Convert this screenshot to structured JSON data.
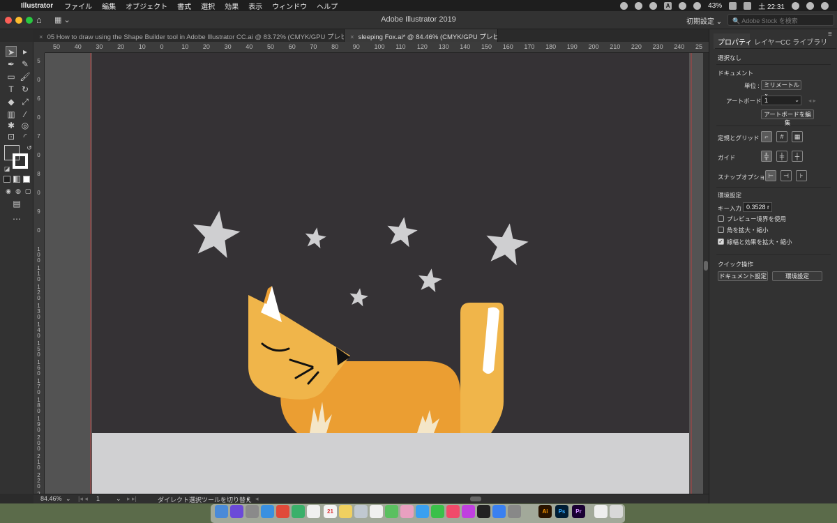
{
  "menubar": {
    "app": "Illustrator",
    "items": [
      "ファイル",
      "編集",
      "オブジェクト",
      "書式",
      "選択",
      "効果",
      "表示",
      "ウィンドウ",
      "ヘルプ"
    ],
    "battery": "43%",
    "clock": "土 22:31"
  },
  "appbar": {
    "title": "Adobe Illustrator 2019",
    "preset": "初期設定 ⌄",
    "stock_placeholder": "Adobe Stock を検索"
  },
  "tabs": [
    {
      "label": "05 How to draw using the Shape Builder tool in Adobe Illustrator CC.ai @ 83.72% (CMYK/GPU プレビュー)"
    },
    {
      "label": "sleeping Fox.ai* @ 84.46% (CMYK/GPU プレビュー)"
    }
  ],
  "ruler_h": [
    "50",
    "40",
    "30",
    "20",
    "10",
    "0",
    "10",
    "20",
    "30",
    "40",
    "50",
    "60",
    "70",
    "80",
    "90",
    "100",
    "110",
    "120",
    "130",
    "140",
    "150",
    "160",
    "170",
    "180",
    "190",
    "200",
    "210",
    "220",
    "230",
    "240",
    "25"
  ],
  "ruler_v": [
    "5",
    "0",
    "6",
    "0",
    "7",
    "0",
    "8",
    "0",
    "9",
    "0",
    "1 0 0",
    "1 1 0",
    "1 2 0",
    "1 3 0",
    "1 4 0",
    "1 5 0",
    "1 6 0",
    "1 7 0",
    "1 8 0",
    "1 9 0",
    "2 0 0",
    "2 1 0",
    "2 2 0",
    "2 3 0"
  ],
  "status": {
    "zoom": "84.46%",
    "artboard": "1",
    "tool_hint": "ダイレクト選択ツールを切り替え"
  },
  "panel": {
    "tabs": [
      "プロパティ",
      "レイヤー",
      "CC ライブラリ"
    ],
    "selection": "選択なし",
    "document_heading": "ドキュメント",
    "units_label": "単位 :",
    "units_value": "ミリメートル",
    "artboard_label": "アートボード :",
    "artboard_value": "1",
    "edit_artboards": "アートボードを編集",
    "rulers_grids": "定規とグリッド",
    "guides": "ガイド",
    "snap_options": "スナップオプション",
    "prefs_heading": "環境設定",
    "key_input_label": "キー入力 :",
    "key_input_value": "0.3528 r",
    "checkboxes": [
      {
        "label": "プレビュー境界を使用",
        "checked": false
      },
      {
        "label": "角を拡大・縮小",
        "checked": false
      },
      {
        "label": "線幅と効果を拡大・縮小",
        "checked": true
      }
    ],
    "quick_actions": "クイック操作",
    "doc_settings": "ドキュメント設定",
    "prefs_button": "環境設定"
  },
  "artwork": {
    "background": "#353235",
    "ground": "#d0d0d2",
    "fox_head": "#f0b54a",
    "fox_body": "#eb9e32",
    "star": "#cfcfd1"
  }
}
